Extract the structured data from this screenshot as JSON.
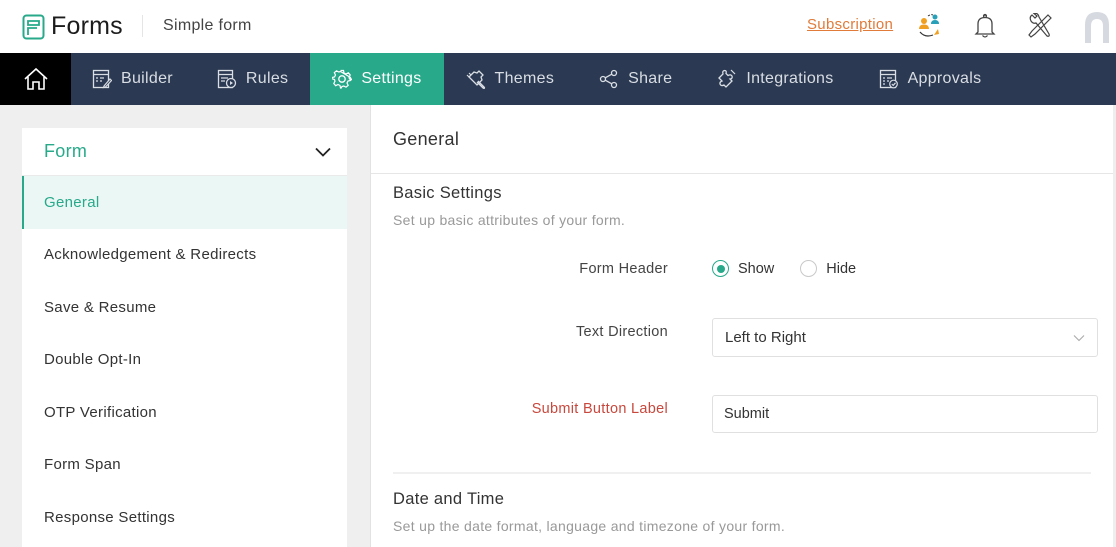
{
  "header": {
    "app_name": "Forms",
    "form_name": "Simple form",
    "subscription_link": "Subscription",
    "icons": [
      "user-switch-icon",
      "bell-icon",
      "tools-icon",
      "avatar"
    ]
  },
  "nav": {
    "home_icon": "home-icon",
    "items": [
      {
        "label": "Builder",
        "icon": "builder-icon",
        "active": false
      },
      {
        "label": "Rules",
        "icon": "rules-icon",
        "active": false
      },
      {
        "label": "Settings",
        "icon": "gear-icon",
        "active": true
      },
      {
        "label": "Themes",
        "icon": "brush-icon",
        "active": false
      },
      {
        "label": "Share",
        "icon": "share-icon",
        "active": false
      },
      {
        "label": "Integrations",
        "icon": "puzzle-icon",
        "active": false
      },
      {
        "label": "Approvals",
        "icon": "approvals-icon",
        "active": false
      }
    ]
  },
  "sidebar": {
    "header": "Form",
    "items": [
      {
        "label": "General",
        "active": true
      },
      {
        "label": "Acknowledgement & Redirects",
        "active": false
      },
      {
        "label": "Save & Resume",
        "active": false
      },
      {
        "label": "Double Opt-In",
        "active": false
      },
      {
        "label": "OTP Verification",
        "active": false
      },
      {
        "label": "Form Span",
        "active": false
      },
      {
        "label": "Response Settings",
        "active": false
      }
    ]
  },
  "main": {
    "title": "General",
    "basic_settings": {
      "title": "Basic Settings",
      "description": "Set up basic attributes of your form.",
      "form_header": {
        "label": "Form Header",
        "options": [
          "Show",
          "Hide"
        ],
        "selected": "Show"
      },
      "text_direction": {
        "label": "Text Direction",
        "value": "Left to Right"
      },
      "submit_button_label": {
        "label": "Submit Button Label",
        "value": "Submit"
      }
    },
    "date_time": {
      "title": "Date and Time",
      "description": "Set up the date format, language and timezone of your form."
    }
  },
  "colors": {
    "accent": "#27a98a",
    "nav_bg": "#2b3a52",
    "link": "#e07b39",
    "required_label": "#c8483d"
  }
}
